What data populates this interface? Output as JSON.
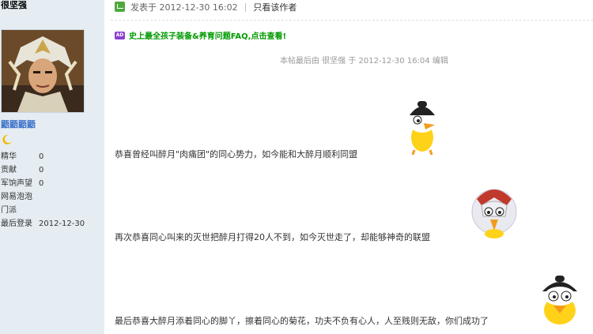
{
  "author": {
    "name": "很坚强",
    "rank": "鼯鼯鼯鼯",
    "stats": [
      {
        "label": "精华",
        "value": "0"
      },
      {
        "label": "贡献",
        "value": "0"
      },
      {
        "label": "军饷声望",
        "value": "0"
      },
      {
        "label": "网易泡泡",
        "value": ""
      },
      {
        "label": "门派",
        "value": ""
      },
      {
        "label": "最后登录",
        "value": "2012-12-30"
      }
    ]
  },
  "post": {
    "posted_at": "发表于 2012-12-30 16:02",
    "only_author_link": "只看该作者",
    "ad_badge": "AD",
    "ad_text": "史上最全孩子装备&养育问题FAQ,点击查看!",
    "edited_note": "本帖最后由 很坚强 于 2012-12-30 16:04 编辑",
    "paragraphs": [
      "恭喜曾经叫醉月\"肉痛团\"的同心势力，如今能和大醉月顺利同盟",
      "再次恭喜同心叫来的灭世把醉月打得20人不到，如今灭世走了，却能够神奇的联盟",
      "最后恭喜大醉月添着同心的脚丫，擦着同心的菊花，功夫不负有心人，人至贱则无敌，你们成功了"
    ]
  },
  "colors": {
    "sidebar_bg": "#e5edf2",
    "rank_color": "#3d72c9",
    "ad_color": "#009900"
  },
  "icons": [
    "post-status-icon",
    "moon-icon",
    "ad-badge-icon",
    "duck-emoticon"
  ]
}
